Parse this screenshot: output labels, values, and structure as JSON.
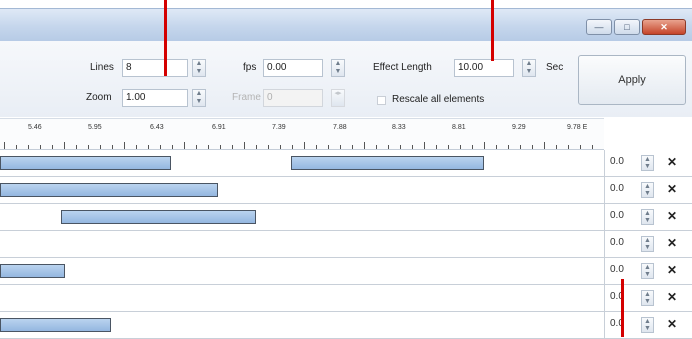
{
  "window": {
    "min_glyph": "—",
    "max_glyph": "□",
    "close_glyph": "✕"
  },
  "toolbar": {
    "lines_label": "Lines",
    "lines_value": "8",
    "zoom_label": "Zoom",
    "zoom_value": "1.00",
    "fps_label": "fps",
    "fps_value": "0.00",
    "frame_label": "Frame",
    "frame_value": "0",
    "effect_length_label": "Effect Length",
    "effect_length_value": "10.00",
    "effect_length_unit": "Sec",
    "rescale_label": "Rescale all elements",
    "apply_label": "Apply"
  },
  "ruler": {
    "labels": [
      "5.46",
      "5.95",
      "6.43",
      "6.91",
      "7.39",
      "7.88",
      "8.33",
      "8.81",
      "9.29",
      "9.78 E"
    ]
  },
  "tracks": [
    {
      "value": "0.0",
      "delete": "✕"
    },
    {
      "value": "0.0",
      "delete": "✕"
    },
    {
      "value": "0.0",
      "delete": "✕"
    },
    {
      "value": "0.0",
      "delete": "✕"
    },
    {
      "value": "0.0",
      "delete": "✕"
    },
    {
      "value": "0.0",
      "delete": "✕"
    },
    {
      "value": "0.0",
      "delete": "✕"
    }
  ],
  "colors": {
    "bar_fill": "#a8c6ea",
    "annotation_red": "#d40000",
    "title_bar": "#c5d6ec"
  }
}
